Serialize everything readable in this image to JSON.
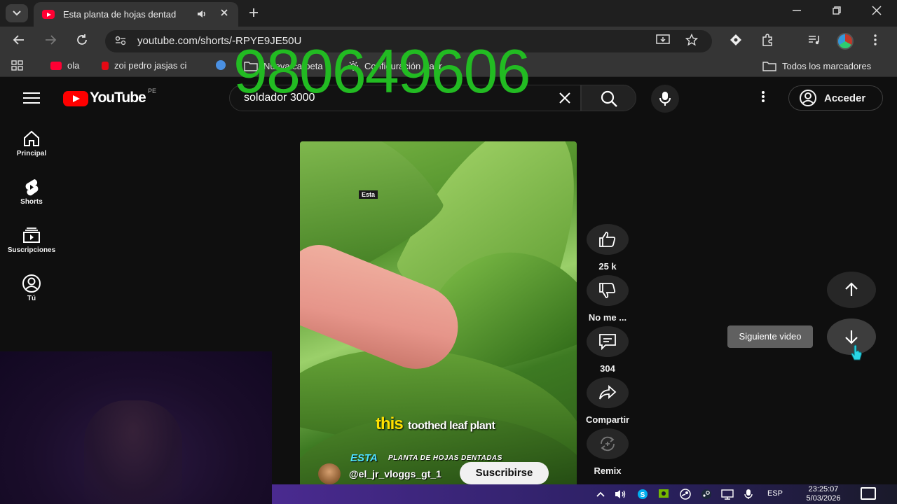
{
  "browser": {
    "tab_title": "Esta planta de hojas dentad",
    "url": "youtube.com/shorts/-RPYE9JE50U",
    "bookmarks": [
      {
        "label": "ola",
        "icon": "youtube-icon"
      },
      {
        "label": "zoi pedro jasjas ci",
        "icon": "netflix-icon"
      },
      {
        "label": "Nueva carpeta",
        "icon": "folder-icon"
      },
      {
        "label": "Configuración Sacr...",
        "icon": "gear-icon"
      }
    ],
    "all_bookmarks_label": "Todos los marcadores"
  },
  "overlay_number": "980649606",
  "youtube": {
    "logo_text": "YouTube",
    "country_code": "PE",
    "search_value": "soldador 3000",
    "signin_label": "Acceder",
    "sidebar": [
      {
        "label": "Principal",
        "icon": "home-icon"
      },
      {
        "label": "Shorts",
        "icon": "shorts-icon"
      },
      {
        "label": "Suscripciones",
        "icon": "subscriptions-icon"
      },
      {
        "label": "Tú",
        "icon": "account-icon"
      }
    ],
    "video": {
      "sticker_text": "Esta",
      "caption_highlight": "this",
      "caption_rest": "toothed leaf plant",
      "caption_es_highlight": "ESTA",
      "caption_es_rest": "PLANTA DE HOJAS DENTADAS",
      "channel": "@el_jr_vloggs_gt_1",
      "subscribe_label": "Suscribirse"
    },
    "actions": {
      "likes": "25 k",
      "dislike": "No me ...",
      "comments": "304",
      "share": "Compartir",
      "remix": "Remix"
    },
    "next_tooltip": "Siguiente video"
  },
  "taskbar": {
    "language": "ESP",
    "time": "23:25:07",
    "date": "5/03/2026"
  },
  "colors": {
    "youtube_red": "#ff0000",
    "overlay_green": "#22bb22",
    "background": "#0f0f0f"
  }
}
